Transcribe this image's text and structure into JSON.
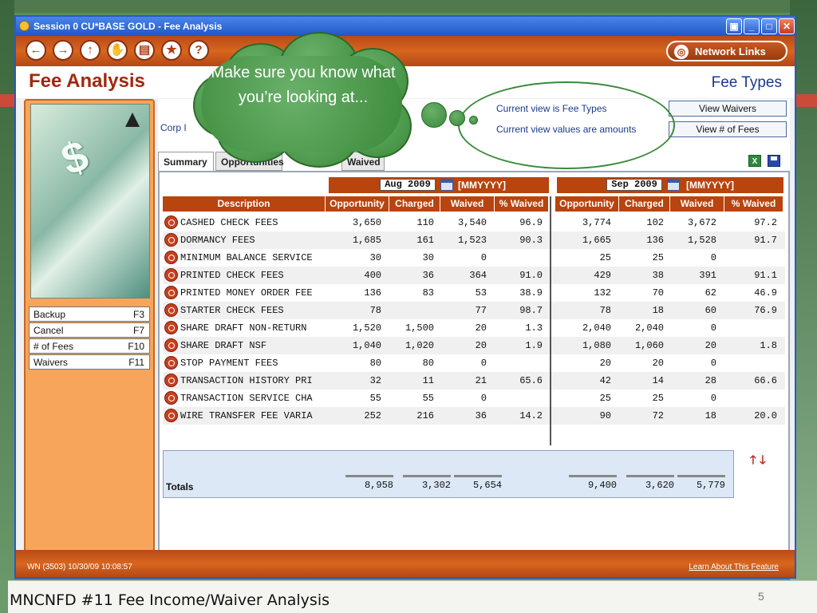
{
  "slide": {
    "title": "MNCNFD #11 Fee Income/Waiver Analysis",
    "page_number": "5"
  },
  "window": {
    "title": "Session 0 CU*BASE GOLD - Fee Analysis",
    "network_links": "Network Links"
  },
  "header": {
    "title": "Fee Analysis",
    "view_name": "Fee Types",
    "corp_label": "Corp I"
  },
  "views": {
    "current_view": "Current view is Fee Types",
    "current_values": "Current view values are amounts",
    "view_waivers": "View Waivers",
    "view_num_fees": "View # of Fees"
  },
  "tabs": [
    {
      "label": "Summary",
      "active": true
    },
    {
      "label": "Opportunities"
    },
    {
      "label": "Waived"
    }
  ],
  "function_keys": [
    {
      "label": "Backup",
      "key": "F3"
    },
    {
      "label": "Cancel",
      "key": "F7"
    },
    {
      "label": "# of Fees",
      "key": "F10"
    },
    {
      "label": "Waivers",
      "key": "F11"
    }
  ],
  "periods": [
    {
      "value": "Aug 2009",
      "format": "[MMYYYY]"
    },
    {
      "value": "Sep 2009",
      "format": "[MMYYYY]"
    }
  ],
  "columns": {
    "description": "Description",
    "group": [
      "Opportunity",
      "Charged",
      "Waived",
      "% Waived"
    ]
  },
  "rows": [
    {
      "desc": "CASHED CHECK FEES",
      "p1": [
        "3,650",
        "110",
        "3,540",
        "96.9"
      ],
      "p2": [
        "3,774",
        "102",
        "3,672",
        "97.2"
      ]
    },
    {
      "desc": "DORMANCY FEES",
      "p1": [
        "1,685",
        "161",
        "1,523",
        "90.3"
      ],
      "p2": [
        "1,665",
        "136",
        "1,528",
        "91.7"
      ]
    },
    {
      "desc": "MINIMUM BALANCE SERVICE",
      "p1": [
        "30",
        "30",
        "0",
        ""
      ],
      "p2": [
        "25",
        "25",
        "0",
        ""
      ]
    },
    {
      "desc": "PRINTED CHECK FEES",
      "p1": [
        "400",
        "36",
        "364",
        "91.0"
      ],
      "p2": [
        "429",
        "38",
        "391",
        "91.1"
      ]
    },
    {
      "desc": "PRINTED MONEY ORDER FEE",
      "p1": [
        "136",
        "83",
        "53",
        "38.9"
      ],
      "p2": [
        "132",
        "70",
        "62",
        "46.9"
      ]
    },
    {
      "desc": "STARTER CHECK FEES",
      "p1": [
        "78",
        "",
        "77",
        "98.7"
      ],
      "p2": [
        "78",
        "18",
        "60",
        "76.9"
      ]
    },
    {
      "desc": "SHARE DRAFT NON-RETURN",
      "p1": [
        "1,520",
        "1,500",
        "20",
        "1.3"
      ],
      "p2": [
        "2,040",
        "2,040",
        "0",
        ""
      ]
    },
    {
      "desc": "SHARE DRAFT NSF",
      "p1": [
        "1,040",
        "1,020",
        "20",
        "1.9"
      ],
      "p2": [
        "1,080",
        "1,060",
        "20",
        "1.8"
      ]
    },
    {
      "desc": "STOP PAYMENT FEES",
      "p1": [
        "80",
        "80",
        "0",
        ""
      ],
      "p2": [
        "20",
        "20",
        "0",
        ""
      ]
    },
    {
      "desc": "TRANSACTION HISTORY PRI",
      "p1": [
        "32",
        "11",
        "21",
        "65.6"
      ],
      "p2": [
        "42",
        "14",
        "28",
        "66.6"
      ]
    },
    {
      "desc": "TRANSACTION SERVICE CHA",
      "p1": [
        "55",
        "55",
        "0",
        ""
      ],
      "p2": [
        "25",
        "25",
        "0",
        ""
      ]
    },
    {
      "desc": "WIRE TRANSFER FEE VARIA",
      "p1": [
        "252",
        "216",
        "36",
        "14.2"
      ],
      "p2": [
        "90",
        "72",
        "18",
        "20.0"
      ]
    }
  ],
  "totals": {
    "label": "Totals",
    "p1": [
      "8,958",
      "3,302",
      "5,654"
    ],
    "p2": [
      "9,400",
      "3,620",
      "5,779"
    ]
  },
  "status": {
    "left": "WN (3503) 10/30/09 10:08:57",
    "right": "Learn About This Feature"
  },
  "callout": {
    "text": "Make sure you know what you’re looking at..."
  },
  "colors": {
    "accent": "#b8440e",
    "callout": "#3a8a3a",
    "title_blue": "#1a3a8a"
  }
}
